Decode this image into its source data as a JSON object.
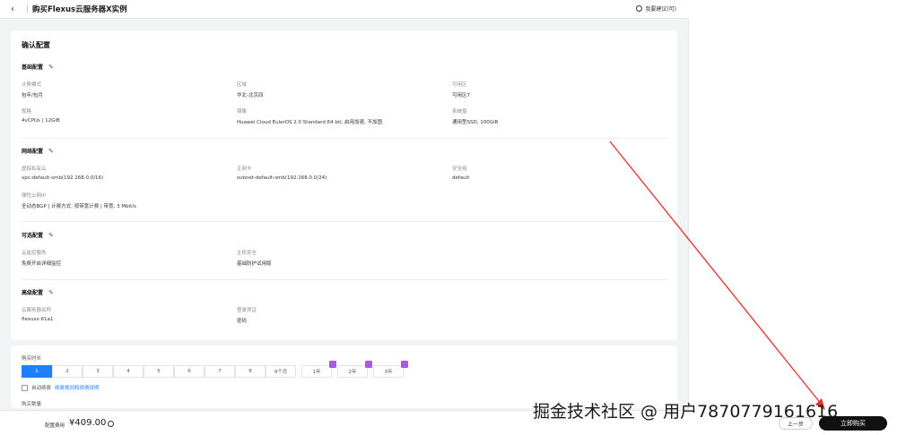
{
  "header": {
    "back_icon": "chevron-left-icon",
    "title": "购买Flexus云服务器X实例",
    "feedback": "我要建议(可)"
  },
  "config": {
    "title": "确认配置",
    "basic": {
      "title": "基础配置",
      "billing_label": "计费模式",
      "billing_value": "包年/包月",
      "region_label": "区域",
      "region_value": "华北-北京四",
      "az_label": "可用区",
      "az_value": "可用区7",
      "spec_label": "规格",
      "spec_value": "4vCPUs | 12GiB",
      "image_label": "镜像",
      "image_value": "Huawei Cloud EulerOS 2.0 Standard 64 bit, 启用加速, 不加固",
      "disk_label": "系统盘",
      "disk_value": "通用型SSD, 100GiB"
    },
    "network": {
      "title": "网络配置",
      "vpc_label": "虚拟私有云",
      "vpc_value": "vpc-default-smb(192.168.0.0/16)",
      "nic_label": "主网卡",
      "nic_value": "subnet-default-smb(192.168.0.0/24)",
      "sg_label": "安全组",
      "sg_value": "default",
      "eip_label": "弹性公网IP",
      "eip_value": "全动态BGP | 计费方式: 按带宽计费 | 带宽: 3 Mbit/s"
    },
    "security": {
      "title": "可选配置",
      "monitor_label": "云监控服务",
      "monitor_value": "免费开启详细监控",
      "host_label": "主机安全",
      "host_value": "基础防护试用版"
    },
    "advanced": {
      "title": "高级配置",
      "name_label": "云服务器名称",
      "name_value": "flexusx-61a1",
      "login_label": "登录凭证",
      "login_value": "密码"
    }
  },
  "purchase": {
    "duration_label": "购买时长",
    "durations": [
      "1",
      "2",
      "3",
      "4",
      "5",
      "6",
      "7",
      "8",
      "9个月",
      "1年",
      "2年",
      "3年"
    ],
    "auto_renew": "自动续费",
    "auto_renew_link": "续费规则和续费说明",
    "quantity_label": "购买数量"
  },
  "footer": {
    "price_label": "配置费用",
    "price": "¥409.00",
    "prev_button": "上一步",
    "pay_button": "立即购买"
  },
  "watermark": "掘金技术社区 @ 用户787077916161​6"
}
